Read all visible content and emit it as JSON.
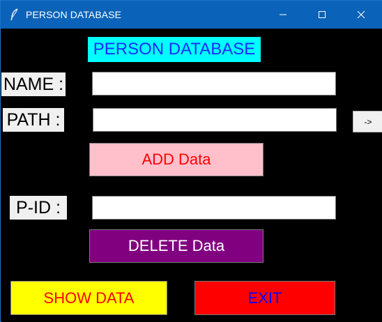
{
  "window": {
    "title": "PERSON DATABASE"
  },
  "heading": "PERSON DATABASE",
  "form": {
    "name_label": "NAME :",
    "name_value": "",
    "path_label": "PATH :",
    "path_value": "",
    "browse_label": "->",
    "add_label": "ADD Data",
    "pid_label": "P-ID :",
    "pid_value": "",
    "delete_label": "DELETE Data"
  },
  "footer": {
    "show_label": "SHOW DATA",
    "exit_label": "EXIT"
  },
  "colors": {
    "titlebar": "#0a63b8",
    "heading_bg": "#00ffff",
    "heading_fg": "#1a2bff",
    "add_bg": "#ffc0cb",
    "add_fg": "#ff0000",
    "delete_bg": "#800080",
    "delete_fg": "#ffffff",
    "show_bg": "#ffff00",
    "show_fg": "#ff0000",
    "exit_bg": "#ff0000",
    "exit_fg": "#0000ff"
  }
}
